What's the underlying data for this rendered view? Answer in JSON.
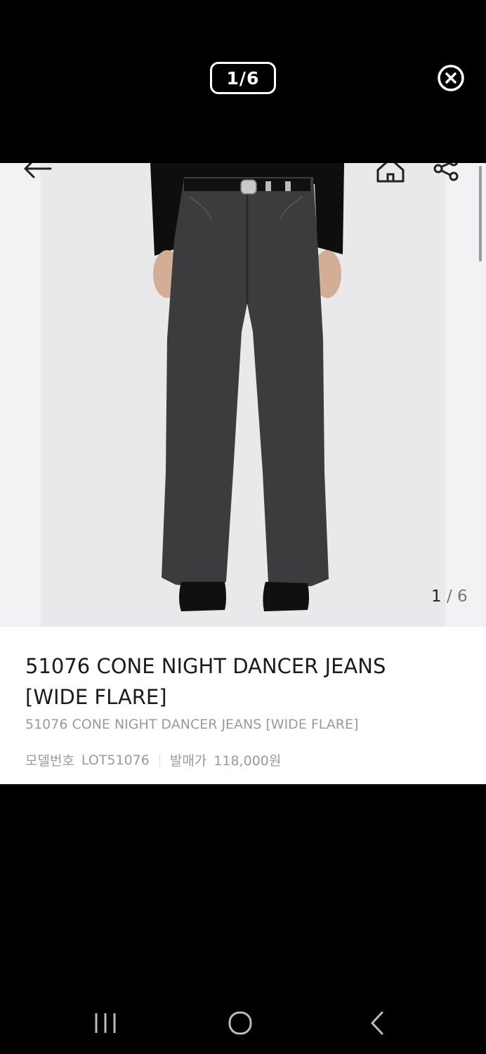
{
  "viewer": {
    "counter": "1/6"
  },
  "product": {
    "image_counter_current": "1",
    "image_counter_total": "/ 6",
    "title": "51076 CONE NIGHT DANCER JEANS [WIDE FLARE]",
    "subtitle": "51076 CONE NIGHT DANCER JEANS [WIDE FLARE]",
    "model_label": "모델번호",
    "model_value": "LOT51076",
    "price_label": "발매가",
    "price_value": "118,000원"
  },
  "icons": {
    "close": "close-circle-icon",
    "back": "arrow-left-icon",
    "home": "home-icon",
    "share": "share-icon",
    "recent": "recent-apps-icon",
    "sys_home": "home-circle-icon",
    "sys_back": "chevron-left-icon"
  }
}
